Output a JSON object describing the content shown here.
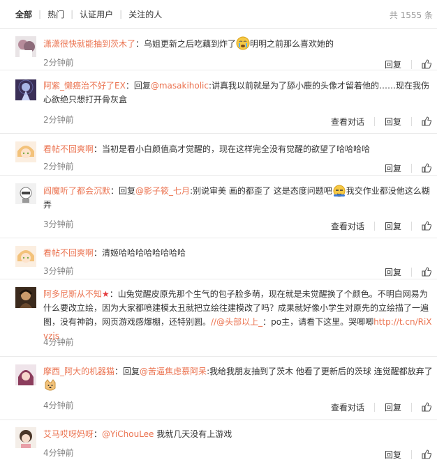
{
  "tabs": {
    "all": "全部",
    "hot": "热门",
    "verified": "认证用户",
    "following": "关注的人"
  },
  "total_text": "共 1555 条",
  "actions": {
    "view_conversation": "查看对话",
    "reply": "回复"
  },
  "comments": [
    {
      "user": "潇潇很快就能抽到茨木了",
      "colon": "：",
      "text_a": "乌姐更新之后吃藕到炸了",
      "emoji": "crying-face",
      "text_b": "明明之前那么喜欢她的",
      "time": "2分钟前"
    },
    {
      "user": "阿紫_懒癌治不好了EX",
      "colon": "：",
      "reply_prefix": "回复",
      "mention": "@masakiholic",
      "text_a": ":讲真我以前就是为了舔小鹿的头像才留着他的……现在我伤心欲绝只想打开骨灰盒",
      "time": "2分钟前"
    },
    {
      "user": "看帖不回爽啊",
      "colon": "：",
      "text_a": "当初是看小白颜值高才觉醒的，现在这样完全没有觉醒的欲望了哈哈哈哈",
      "time": "2分钟前"
    },
    {
      "user": "阎魔听了都会沉默",
      "colon": "：",
      "reply_prefix": "回复",
      "mention": "@影子筱_七月",
      "text_a": ":别说审美 画的都歪了 这是态度问题吧",
      "emoji": "doge",
      "text_b": "我交作业都没他这么糊弄",
      "time": "3分钟前"
    },
    {
      "user": "看帖不回爽啊",
      "colon": "：",
      "text_a": "清姬哈哈哈哈哈哈哈哈",
      "time": "3分钟前"
    },
    {
      "user": "阿多尼斯从不知",
      "star": "★",
      "colon": "：",
      "text_a": "山兔觉醒皮原先那个生气的包子脸多萌，现在就是未觉醒换了个颜色。不明白网易为什么要改立绘，因为大家都喷建模太丑就把立绘往建模改了吗？成果就好像小学生对原先的立绘描了一遍图，没有神韵，网页游戏感爆棚，还特别圆。",
      "mention": "//@头部以上_",
      "text_b": "：po主，请看下这里。哭唧唧",
      "link": "http://t.cn/RiXvzjs",
      "time": "4分钟前"
    },
    {
      "user": "摩西_阿大的机器猫",
      "colon": "：",
      "reply_prefix": "回复",
      "mention": "@苦逼焦虑慕阿呆",
      "text_a": ":我给我朋友抽到了茨木 他看了更新后的茨球 连觉醒都放弃了",
      "emoji": "doge-dog",
      "time": "4分钟前"
    },
    {
      "user": "艾马哎呀妈呀",
      "colon": "：",
      "mention": "@YiChouLee",
      "text_a": " 我就几天没有上游戏",
      "time": "4分钟前"
    }
  ]
}
